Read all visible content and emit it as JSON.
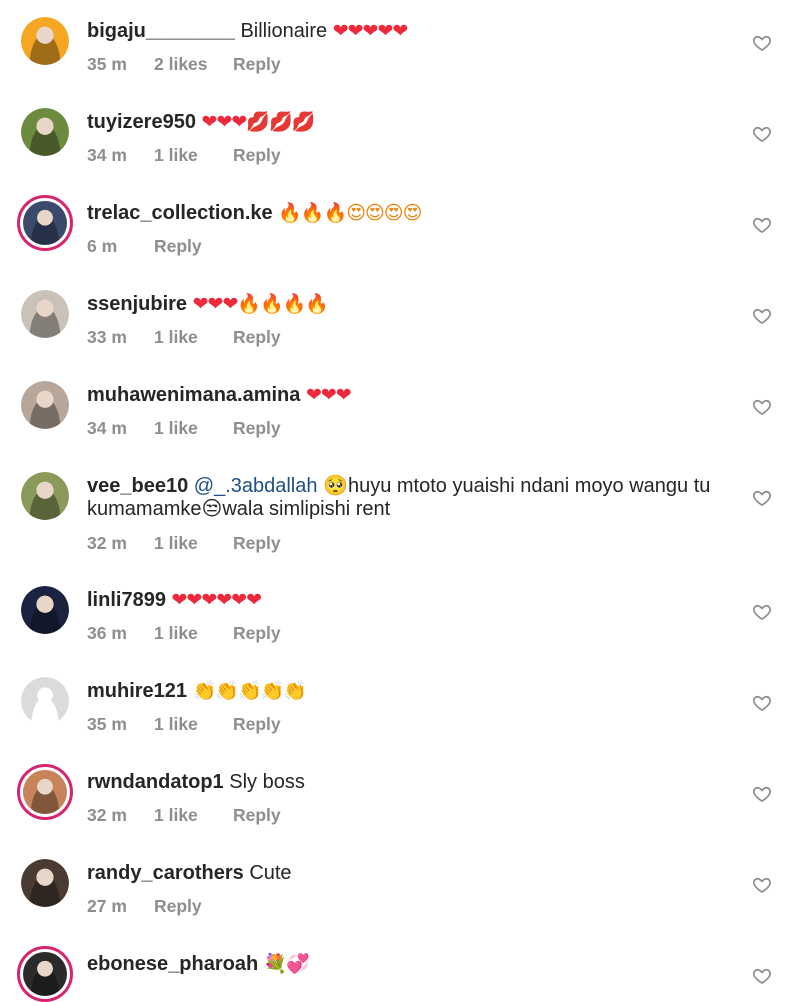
{
  "comments": [
    {
      "username": "bigaju________",
      "text": "Billionaire",
      "emoji": "❤❤❤❤❤",
      "emoji_color": "#ed2a3c",
      "time": "35 m",
      "likes": "2 likes",
      "reply": "Reply",
      "avatar": {
        "bg": "#f5a623",
        "ring": false
      }
    },
    {
      "username": "tuyizere950",
      "text": "",
      "emoji": "❤❤❤💋💋💋",
      "emoji_color": "#ed2a3c",
      "time": "34 m",
      "likes": "1 like",
      "reply": "Reply",
      "avatar": {
        "bg": "#6d8b3e",
        "ring": false
      }
    },
    {
      "username": "trelac_collection.ke",
      "text": "",
      "emoji": "🔥🔥🔥😍😍😍😍",
      "emoji_color": "#f0830e",
      "time": "6 m",
      "likes": "",
      "reply": "Reply",
      "avatar": {
        "bg": "#3b4a6b",
        "ring": true
      }
    },
    {
      "username": "ssenjubire",
      "text": "",
      "emoji": "❤❤❤🔥🔥🔥🔥",
      "emoji_color": "#ed2a3c",
      "time": "33 m",
      "likes": "1 like",
      "reply": "Reply",
      "avatar": {
        "bg": "#c9c2b8",
        "ring": false
      }
    },
    {
      "username": "muhawenimana.amina",
      "text": "",
      "emoji": "❤❤❤",
      "emoji_color": "#ed2a3c",
      "time": "34 m",
      "likes": "1 like",
      "reply": "Reply",
      "avatar": {
        "bg": "#b7a79a",
        "ring": false
      }
    },
    {
      "username": "vee_bee10",
      "mention": "@_.3abdallah",
      "text": "🥺huyu mtoto yuaishi ndani moyo wangu tu kumamamke😒wala simlipishi rent",
      "emoji": "",
      "emoji_color": "#262626",
      "time": "32 m",
      "likes": "1 like",
      "reply": "Reply",
      "avatar": {
        "bg": "#8a9a5b",
        "ring": false
      }
    },
    {
      "username": "linli7899",
      "text": "",
      "emoji": "❤❤❤❤❤❤",
      "emoji_color": "#ed2a3c",
      "time": "36 m",
      "likes": "1 like",
      "reply": "Reply",
      "avatar": {
        "bg": "#1b2340",
        "ring": false
      }
    },
    {
      "username": "muhire121",
      "text": "",
      "emoji": "👏👏👏👏👏",
      "emoji_color": "#e8b53c",
      "time": "35 m",
      "likes": "1 like",
      "reply": "Reply",
      "avatar": {
        "bg": "#dbdbdb",
        "ring": false
      }
    },
    {
      "username": "rwndandatop1",
      "text": "Sly boss",
      "emoji": "",
      "emoji_color": "#262626",
      "time": "32 m",
      "likes": "1 like",
      "reply": "Reply",
      "avatar": {
        "bg": "#c7845a",
        "ring": true
      }
    },
    {
      "username": "randy_carothers",
      "text": "Cute",
      "emoji": "",
      "emoji_color": "#262626",
      "time": "27 m",
      "likes": "",
      "reply": "Reply",
      "avatar": {
        "bg": "#4a3b32",
        "ring": false
      }
    },
    {
      "username": "ebonese_pharoah",
      "text": "",
      "emoji": "💐💞",
      "emoji_color": "#e25a8f",
      "time": "",
      "likes": "",
      "reply": "",
      "avatar": {
        "bg": "#2b2b2b",
        "ring": true
      }
    }
  ]
}
